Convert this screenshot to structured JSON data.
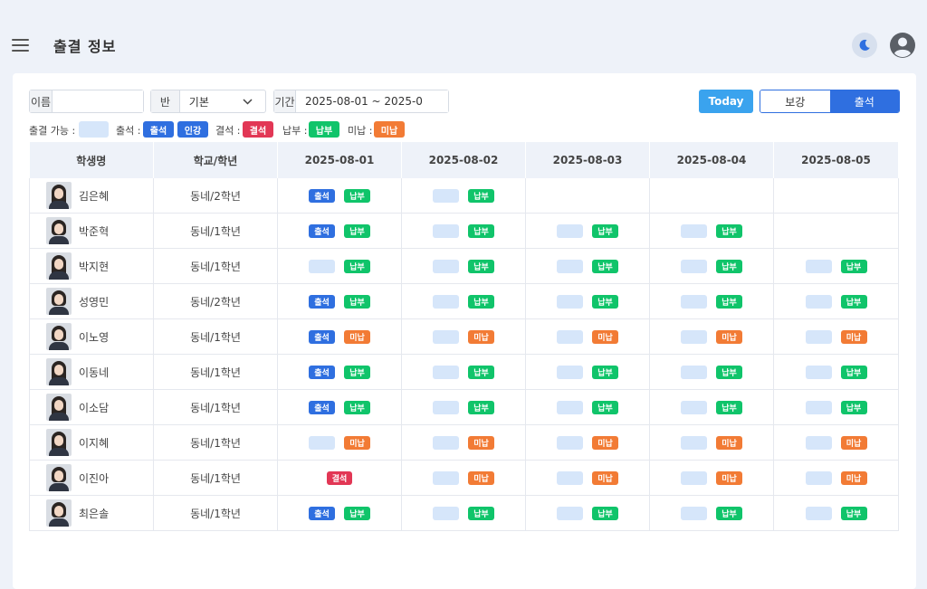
{
  "header": {
    "title": "출결 정보"
  },
  "filters": {
    "name_label": "이름",
    "name_value": "",
    "class_label": "반",
    "class_value": "기본",
    "period_label": "기간",
    "period_value": "2025-08-01 ~ 2025-0"
  },
  "buttons": {
    "today": "Today",
    "makeup": "보강",
    "attendance": "출석"
  },
  "legend": {
    "available": "출결 가능 :",
    "attendance": "출석 :",
    "attend_badge": "출석",
    "cert_badge": "인강",
    "absence": "결석 :",
    "absent_badge": "결석",
    "paid": "납부 :",
    "paid_badge": "납부",
    "unpaid": "미납 :",
    "unpaid_badge": "미납"
  },
  "table": {
    "headers": [
      "학생명",
      "학교/학년",
      "2025-08-01",
      "2025-08-02",
      "2025-08-03",
      "2025-08-04",
      "2025-08-05"
    ],
    "rows": [
      {
        "name": "김은혜",
        "school": "동네/2학년",
        "days": [
          [
            "att",
            "paid"
          ],
          [
            "avail",
            "paid"
          ],
          [],
          [],
          []
        ]
      },
      {
        "name": "박준혁",
        "school": "동네/1학년",
        "days": [
          [
            "att",
            "paid"
          ],
          [
            "avail",
            "paid"
          ],
          [
            "avail",
            "paid"
          ],
          [
            "avail",
            "paid"
          ],
          []
        ]
      },
      {
        "name": "박지현",
        "school": "동네/1학년",
        "days": [
          [
            "avail",
            "paid"
          ],
          [
            "avail",
            "paid"
          ],
          [
            "avail",
            "paid"
          ],
          [
            "avail",
            "paid"
          ],
          [
            "avail",
            "paid"
          ]
        ]
      },
      {
        "name": "성영민",
        "school": "동네/2학년",
        "days": [
          [
            "att",
            "paid"
          ],
          [
            "avail",
            "paid"
          ],
          [
            "avail",
            "paid"
          ],
          [
            "avail",
            "paid"
          ],
          [
            "avail",
            "paid"
          ]
        ]
      },
      {
        "name": "이노영",
        "school": "동네/1학년",
        "days": [
          [
            "att",
            "unpaid"
          ],
          [
            "avail",
            "unpaid"
          ],
          [
            "avail",
            "unpaid"
          ],
          [
            "avail",
            "unpaid"
          ],
          [
            "avail",
            "unpaid"
          ]
        ]
      },
      {
        "name": "이동네",
        "school": "동네/1학년",
        "days": [
          [
            "att",
            "paid"
          ],
          [
            "avail",
            "paid"
          ],
          [
            "avail",
            "paid"
          ],
          [
            "avail",
            "paid"
          ],
          [
            "avail",
            "paid"
          ]
        ]
      },
      {
        "name": "이소담",
        "school": "동네/1학년",
        "days": [
          [
            "att",
            "paid"
          ],
          [
            "avail",
            "paid"
          ],
          [
            "avail",
            "paid"
          ],
          [
            "avail",
            "paid"
          ],
          [
            "avail",
            "paid"
          ]
        ]
      },
      {
        "name": "이지혜",
        "school": "동네/1학년",
        "days": [
          [
            "avail",
            "unpaid"
          ],
          [
            "avail",
            "unpaid"
          ],
          [
            "avail",
            "unpaid"
          ],
          [
            "avail",
            "unpaid"
          ],
          [
            "avail",
            "unpaid"
          ]
        ]
      },
      {
        "name": "이진아",
        "school": "동네/1학년",
        "days": [
          [
            "abs"
          ],
          [
            "avail",
            "unpaid"
          ],
          [
            "avail",
            "unpaid"
          ],
          [
            "avail",
            "unpaid"
          ],
          [
            "avail",
            "unpaid"
          ]
        ]
      },
      {
        "name": "최은솔",
        "school": "동네/1학년",
        "days": [
          [
            "att",
            "paid"
          ],
          [
            "avail",
            "paid"
          ],
          [
            "avail",
            "paid"
          ],
          [
            "avail",
            "paid"
          ],
          [
            "avail",
            "paid"
          ]
        ]
      }
    ]
  },
  "badges": {
    "att": "출석",
    "paid": "납부",
    "unpaid": "미납",
    "abs": "결석",
    "avail": ""
  },
  "colors": {
    "attendance": "#2f6fe0",
    "available": "#d6e6fa",
    "absent": "#e23755",
    "paid": "#10c46a",
    "unpaid": "#f27b35",
    "today": "#3aa3ee"
  },
  "icons": {
    "menu": "hamburger-icon",
    "theme": "moon-icon",
    "account": "user-circle-icon",
    "select": "chevron-down-icon"
  }
}
